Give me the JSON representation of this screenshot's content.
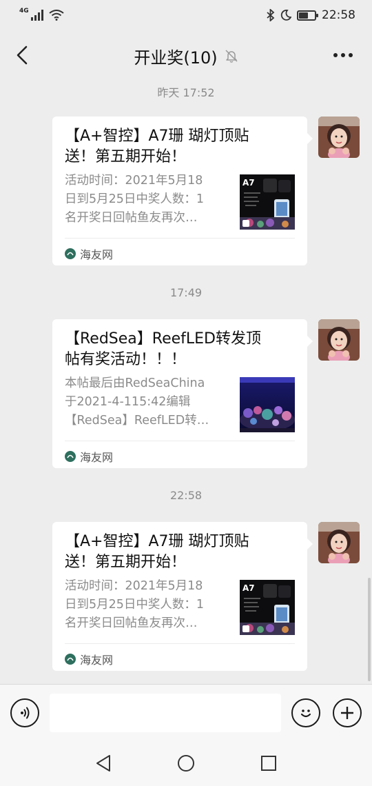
{
  "status_bar": {
    "network": "4G",
    "time": "22:58",
    "battery_level_pct": 60
  },
  "header": {
    "title": "开业奖(10)",
    "back_icon": "chevron-left-icon",
    "muted_icon": "bell-muted-icon",
    "more_icon": "more-horizontal-icon"
  },
  "messages": [
    {
      "timestamp": "昨天 17:52",
      "title_lines": [
        "【A+智控】A7珊 瑚灯顶贴",
        "送！第五期开始！"
      ],
      "desc_lines": [
        "活动时间：2021年5月18",
        "日到5月25日中奖人数：1",
        "名开奖日回帖鱼友再次…"
      ],
      "thumbnail": "a7-led-light-thumbnail",
      "thumb_text": "A7",
      "source": "海友网"
    },
    {
      "timestamp": "17:49",
      "title_lines": [
        "【RedSea】ReefLED转发顶",
        "帖有奖活动！！！"
      ],
      "desc_lines": [
        "本帖最后由RedSeaChina",
        "于2021-4-115:42编辑",
        "【RedSea】ReefLED转…"
      ],
      "thumbnail": "reef-aquarium-thumbnail",
      "source": "海友网"
    },
    {
      "timestamp": "22:58",
      "title_lines": [
        "【A+智控】A7珊 瑚灯顶贴",
        "送！第五期开始！"
      ],
      "desc_lines": [
        "活动时间：2021年5月18",
        "日到5月25日中奖人数：1",
        "名开奖日回帖鱼友再次…"
      ],
      "thumbnail": "a7-led-light-thumbnail",
      "thumb_text": "A7",
      "source": "海友网"
    }
  ],
  "input_bar": {
    "voice_icon": "voice-input-icon",
    "emoji_icon": "emoji-icon",
    "plus_icon": "plus-icon",
    "input_value": ""
  },
  "nav_bar": {
    "back_icon": "triangle-back-icon",
    "home_icon": "circle-home-icon",
    "recent_icon": "square-recent-icon"
  },
  "colors": {
    "background": "#ededed",
    "card": "#ffffff",
    "secondary_text": "#8b8b8b",
    "source_logo": "#2e6f5e"
  }
}
